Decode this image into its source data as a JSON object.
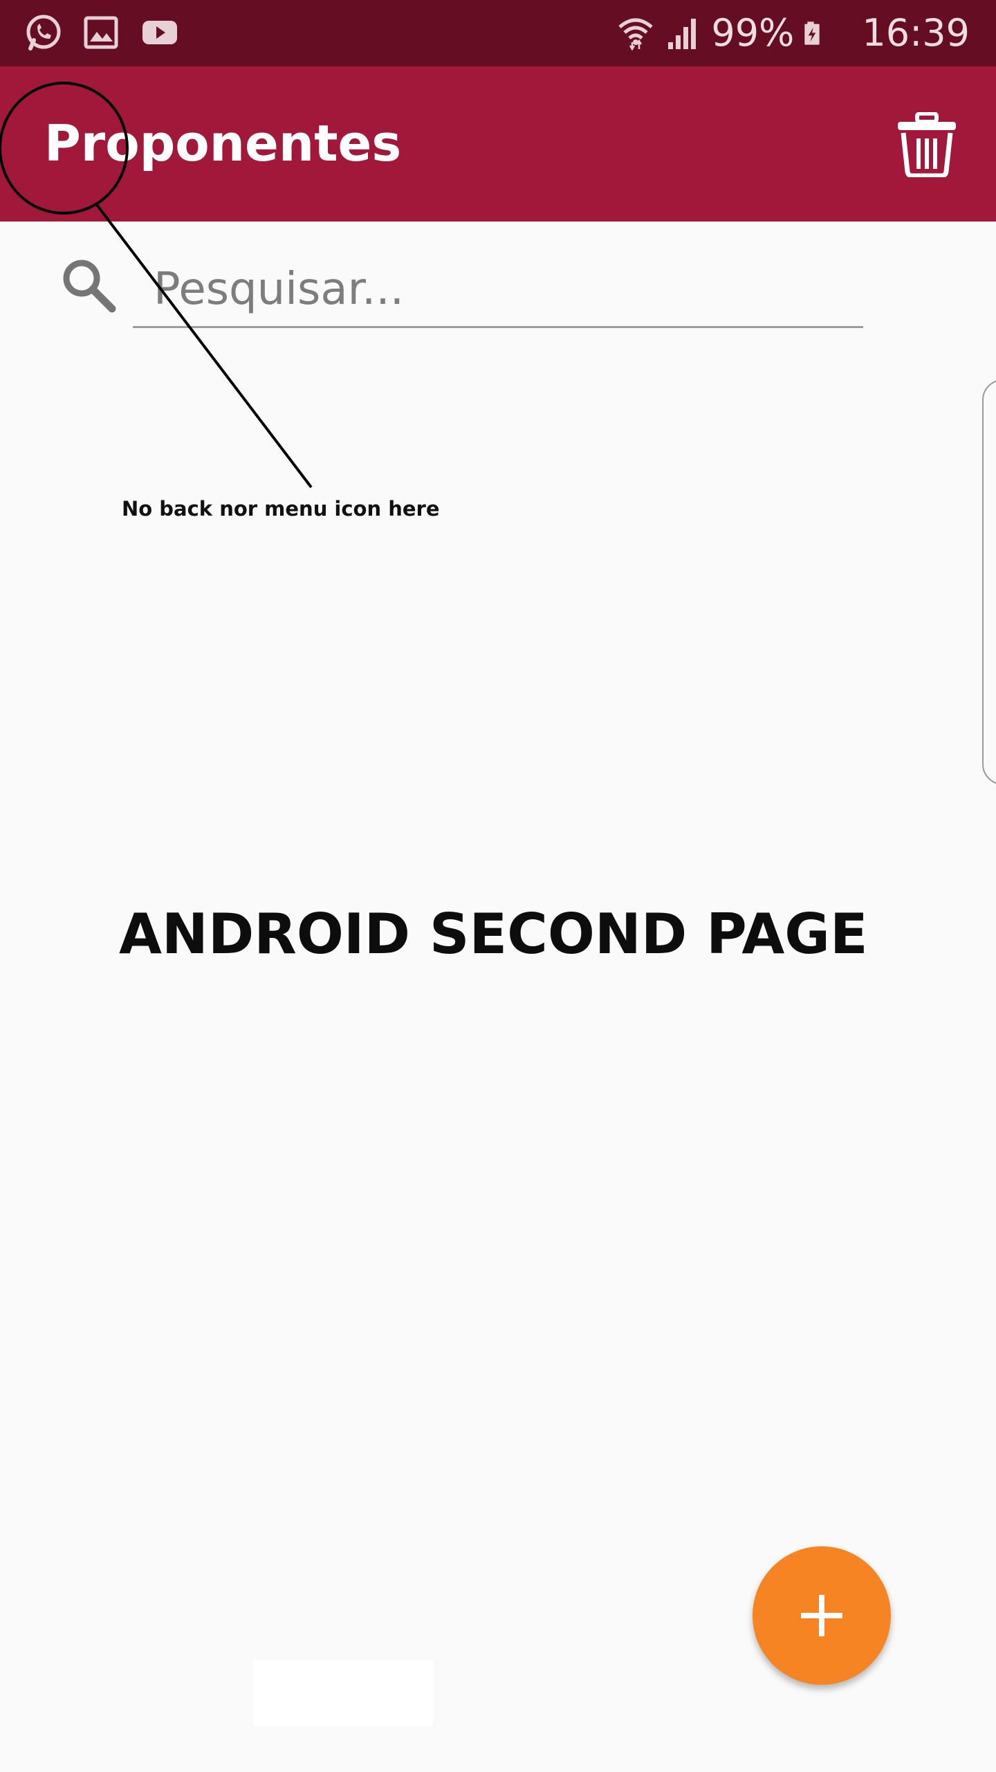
{
  "status_bar": {
    "notification_icons": [
      "whatsapp-icon",
      "gallery-icon",
      "youtube-icon"
    ],
    "system_icons": [
      "wifi-icon",
      "signal-icon",
      "battery-charging-icon"
    ],
    "battery": "99%",
    "time": "16:39"
  },
  "app_bar": {
    "title": "Proponentes",
    "action_icon": "trash-icon"
  },
  "search": {
    "placeholder": "Pesquisar..."
  },
  "annotation": {
    "note": "No back nor menu icon here",
    "page_label": "ANDROID SECOND PAGE"
  },
  "fab": {
    "icon": "plus-icon"
  },
  "colors": {
    "status_bar": "#650d23",
    "app_bar": "#a2183a",
    "fab": "#f68423",
    "background": "#fafafa"
  }
}
